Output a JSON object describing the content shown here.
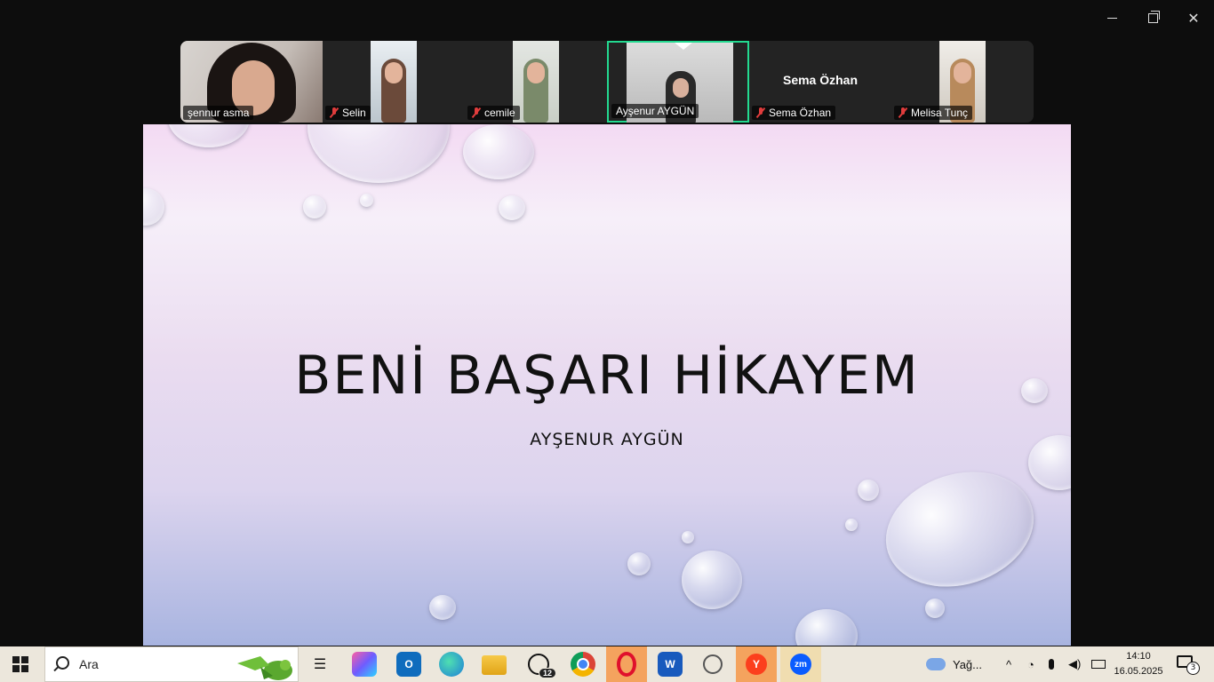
{
  "window": {
    "minimize": "—",
    "maximize": "▢",
    "close": "✕"
  },
  "participants": [
    {
      "name": "şennur asma",
      "muted": false,
      "active": false
    },
    {
      "name": "Selin",
      "muted": true,
      "active": false
    },
    {
      "name": "cemile",
      "muted": true,
      "active": false
    },
    {
      "name": "Ayşenur AYGÜN",
      "muted": false,
      "active": true
    },
    {
      "name": "Sema Özhan",
      "muted": true,
      "active": false,
      "video_off_label": "Sema Özhan"
    },
    {
      "name": "Melisa Tunç",
      "muted": true,
      "active": false
    }
  ],
  "slide": {
    "title": "BENİ BAŞARI HİKAYEM",
    "subtitle": "AYŞENUR AYGÜN"
  },
  "taskbar": {
    "search_placeholder": "Ara",
    "whatsapp_badge": "12",
    "weather_text": "Yağ...",
    "time": "14:10",
    "date": "16.05.2025",
    "notification_count": "3",
    "apps": {
      "outlook": "O",
      "word": "W",
      "yandex": "Y",
      "zoom": "zm"
    }
  },
  "colors": {
    "active_speaker_border": "#23d990",
    "mute_red": "#e03c3c",
    "taskbar_bg": "#ece7dc"
  }
}
